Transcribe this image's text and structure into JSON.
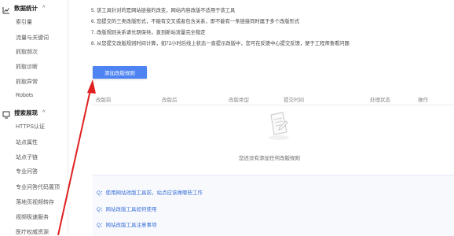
{
  "sidebar": {
    "section1": {
      "label": "数据统计",
      "icon": "chart-icon"
    },
    "section1_items": [
      "索引量",
      "流量与关键词",
      "抓取频次",
      "抓取诊断",
      "抓取异常",
      "Robots"
    ],
    "section2": {
      "label": "搜索展现",
      "icon": "display-icon"
    },
    "section2_items": [
      "HTTPS认证",
      "站点属性",
      "站点子链",
      "专业问答",
      "专业问答代码置顶",
      "落地页视频转存",
      "视频极速服务",
      "医疗权威资源"
    ]
  },
  "notes": [
    "5. 该工具针对的是网站链接的改变，网站内容改版不适用于该工具",
    "6. 您提交的三类改版形式，不能有交叉或者包含关系，即不能有一条链接同时属于多个改版形式",
    "7. 改版规则关系请长期保持，直到新站流量完全稳定",
    "8. 从您提交改版规则时间计算，如72小时后线上状态一直提示改版中，您可在反馈中心提交反馈，便于工程师查看问题"
  ],
  "add_button": "添加改版规则",
  "table": {
    "headers": [
      "改版前",
      "改版后",
      "改版类型",
      "提交时间",
      "处理状态",
      "操作"
    ],
    "empty_text": "您还没有添加任何改版规则"
  },
  "faq": [
    "Q：使用网站改版工具前，站点应该做哪些工作",
    "Q：网站改版工具如何使用",
    "Q：网站改版工具注意事项"
  ],
  "colors": {
    "primary": "#4e83f2",
    "link": "#3a6fd8",
    "arrow": "#e02020"
  }
}
